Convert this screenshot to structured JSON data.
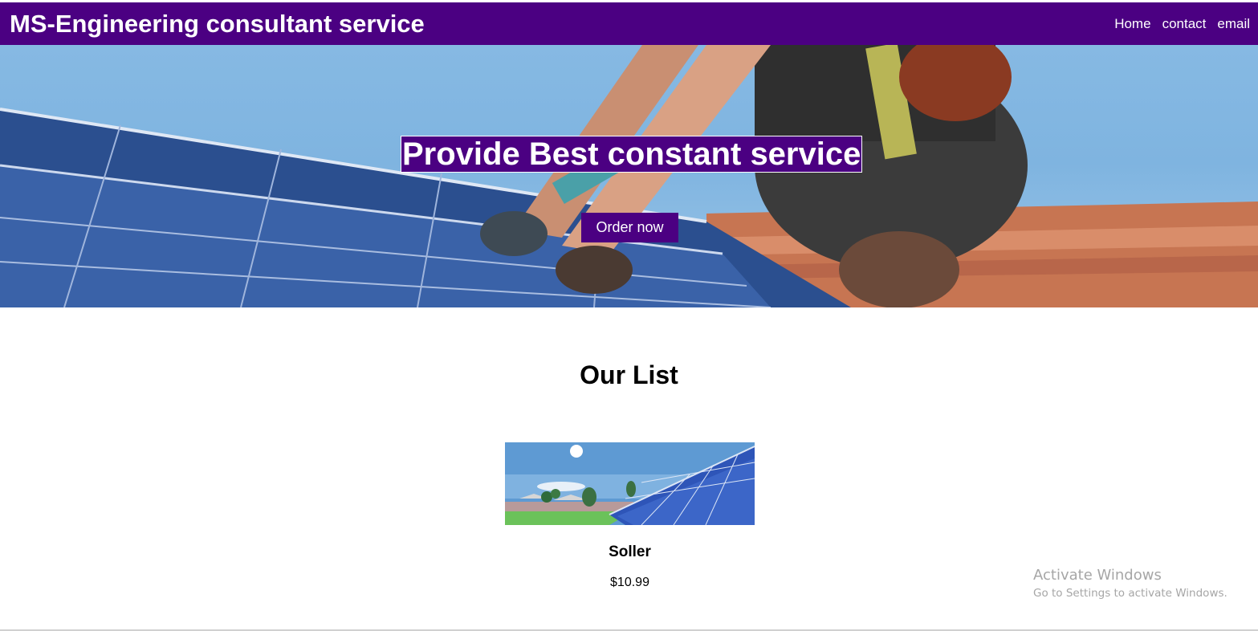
{
  "navbar": {
    "brand": "MS-Engineering consultant service",
    "links": [
      "Home",
      "contact",
      "email"
    ]
  },
  "hero": {
    "title": "Provide Best constant service",
    "button_label": "Order now"
  },
  "list": {
    "title": "Our List",
    "items": [
      {
        "name": "Soller",
        "price": "$10.99"
      }
    ]
  },
  "watermark": {
    "line1": "Activate Windows",
    "line2": "Go to Settings to activate Windows."
  },
  "colors": {
    "brand": "#4b0082",
    "text_on_brand": "#ffffff"
  }
}
